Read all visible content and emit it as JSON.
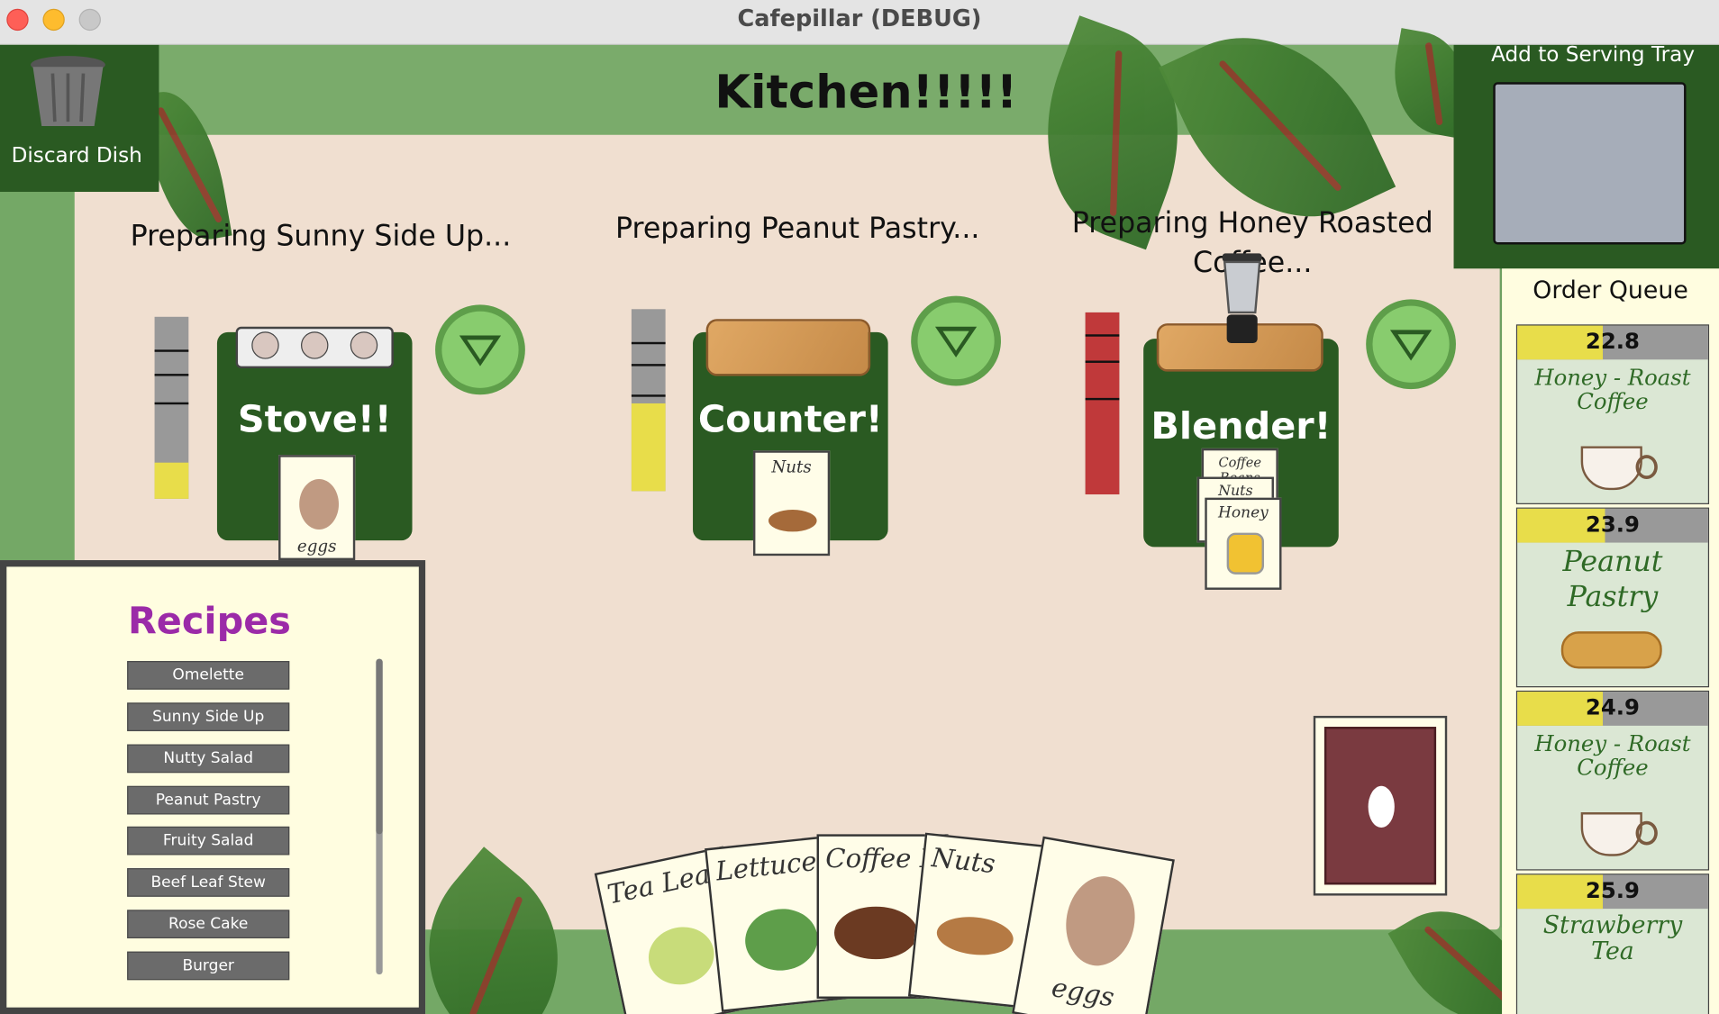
{
  "window": {
    "title": "Cafepillar (DEBUG)"
  },
  "kitchen": {
    "title": "Kitchen!!!!!"
  },
  "discard": {
    "label": "Discard Dish"
  },
  "tray": {
    "label": "Add to Serving Tray"
  },
  "queue": {
    "title": "Order Queue",
    "orders": [
      {
        "time": "22.8",
        "name_line1": "Honey - Roast",
        "name_line2": "Coffee",
        "progress": 0.45
      },
      {
        "time": "23.9",
        "name_line1": "Peanut",
        "name_line2": "Pastry",
        "progress": 0.46
      },
      {
        "time": "24.9",
        "name_line1": "Honey - Roast",
        "name_line2": "Coffee",
        "progress": 0.45
      },
      {
        "time": "25.9",
        "name_line1": "Strawberry",
        "name_line2": "Tea",
        "progress": 0.45
      }
    ]
  },
  "stations": [
    {
      "prep": "Preparing Sunny Side Up...",
      "label": "Stove!!",
      "progress": 0.2,
      "gauge_color": "#e8dd4a",
      "cards": [
        "eggs"
      ]
    },
    {
      "prep": "Preparing Peanut Pastry...",
      "label": "Counter!",
      "progress": 0.48,
      "gauge_color": "#e8dd4a",
      "cards": [
        "Nuts"
      ]
    },
    {
      "prep": "Preparing Honey Roasted Coffee...",
      "label": "Blender!",
      "progress": 1.0,
      "gauge_color": "#c0393a",
      "cards": [
        "Coffee Beans",
        "Nuts",
        "Honey"
      ]
    }
  ],
  "recipes": {
    "title": "Recipes",
    "items": [
      "Omelette",
      "Sunny Side Up",
      "Nutty Salad",
      "Peanut Pastry",
      "Fruity Salad",
      "Beef Leaf Stew",
      "Rose Cake",
      "Burger"
    ]
  },
  "hand": [
    "Tea Leaves",
    "Lettuce",
    "Coffee Beans",
    "Nuts",
    "eggs"
  ]
}
